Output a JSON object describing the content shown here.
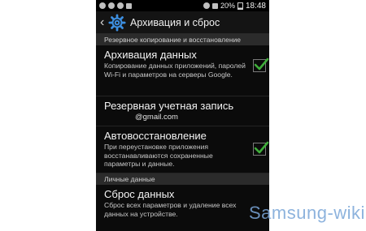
{
  "statusbar": {
    "battery": "20%",
    "time": "18:48"
  },
  "header": {
    "title": "Архивация и сброс"
  },
  "sections": {
    "backup": "Резервное копирование и восстановление",
    "personal": "Личные данные"
  },
  "items": {
    "archive": {
      "title": "Архивация данных",
      "desc": "Копирование данных приложений, паролей Wi-Fi и параметров на серверы Google.",
      "checked": true
    },
    "account": {
      "title": "Резервная учетная запись",
      "email": "@gmail.com"
    },
    "restore": {
      "title": "Автовосстановление",
      "desc": "При переустановке приложения восстанавливаются сохраненные параметры и данные.",
      "checked": true
    },
    "reset": {
      "title": "Сброс данных",
      "desc": "Сброс всех параметров и удаление всех данных на устройстве."
    }
  },
  "watermark": "Samsung-wiki",
  "colors": {
    "check": "#3fae3a",
    "background": "#0b0b0b"
  }
}
